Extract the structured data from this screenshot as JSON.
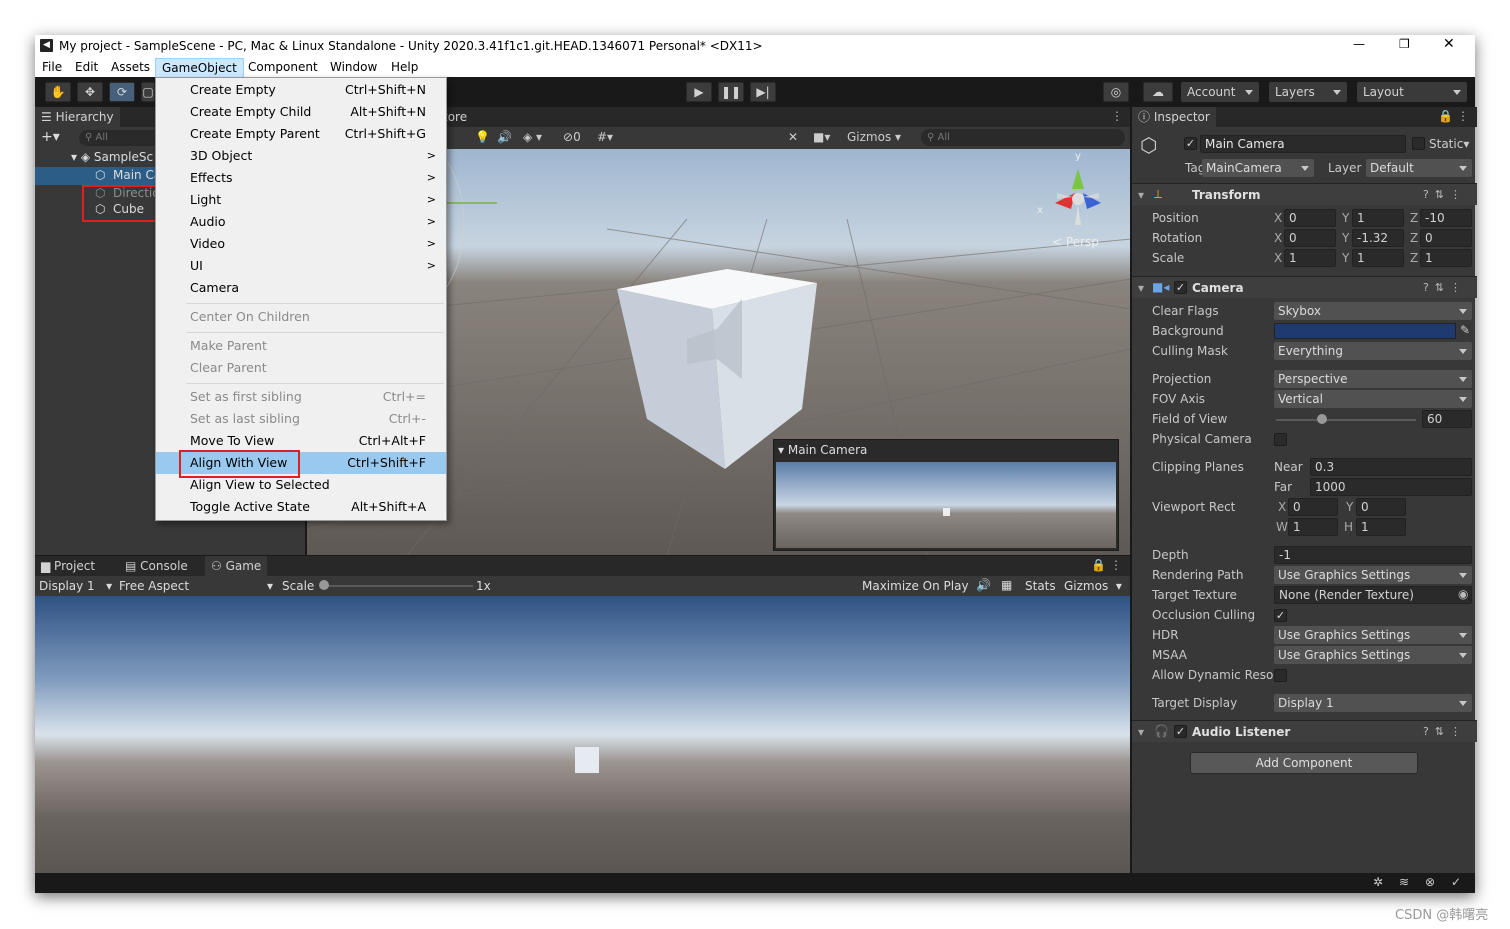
{
  "window": {
    "title": "My project - SampleScene - PC, Mac & Linux Standalone - Unity 2020.3.41f1c1.git.HEAD.1346071 Personal* <DX11>",
    "controls": [
      "—",
      "❐",
      "✕"
    ]
  },
  "menubar": [
    "File",
    "Edit",
    "Assets",
    "GameObject",
    "Component",
    "Window",
    "Help"
  ],
  "toolbar": {
    "account": "Account",
    "layers": "Layers",
    "layout": "Layout"
  },
  "hierarchy": {
    "tab": "Hierarchy",
    "search_placeholder": "All",
    "scene": "SampleSc",
    "items": [
      "Main Ca",
      "Directic",
      "Cube"
    ]
  },
  "scene_view": {
    "tab_fragment": "tore",
    "visibility_count": "0",
    "gizmos": "Gizmos",
    "search_placeholder": "All",
    "persp_label": "< Persp",
    "gizmo_y": "y",
    "gizmo_x": "x",
    "preview_title": "Main Camera"
  },
  "gameobject_menu": {
    "items": [
      {
        "label": "Create Empty",
        "shortcut": "Ctrl+Shift+N"
      },
      {
        "label": "Create Empty Child",
        "shortcut": "Alt+Shift+N"
      },
      {
        "label": "Create Empty Parent",
        "shortcut": "Ctrl+Shift+G"
      },
      {
        "label": "3D Object",
        "shortcut": ">"
      },
      {
        "label": "Effects",
        "shortcut": ">"
      },
      {
        "label": "Light",
        "shortcut": ">"
      },
      {
        "label": "Audio",
        "shortcut": ">"
      },
      {
        "label": "Video",
        "shortcut": ">"
      },
      {
        "label": "UI",
        "shortcut": ">"
      },
      {
        "label": "Camera",
        "shortcut": ""
      },
      {
        "label": "Center On Children",
        "shortcut": ""
      },
      {
        "label": "Make Parent",
        "shortcut": ""
      },
      {
        "label": "Clear Parent",
        "shortcut": ""
      },
      {
        "label": "Set as first sibling",
        "shortcut": "Ctrl+="
      },
      {
        "label": "Set as last sibling",
        "shortcut": "Ctrl+-"
      },
      {
        "label": "Move To View",
        "shortcut": "Ctrl+Alt+F"
      },
      {
        "label": "Align With View",
        "shortcut": "Ctrl+Shift+F"
      },
      {
        "label": "Align View to Selected",
        "shortcut": ""
      },
      {
        "label": "Toggle Active State",
        "shortcut": "Alt+Shift+A"
      }
    ]
  },
  "bottom_panel": {
    "tabs": [
      "Project",
      "Console",
      "Game"
    ],
    "display": "Display 1",
    "aspect": "Free Aspect",
    "scale_label": "Scale",
    "scale_value": "1x",
    "scale_level": 0.0,
    "maximize": "Maximize On Play",
    "stats": "Stats",
    "gizmos": "Gizmos"
  },
  "inspector": {
    "tab": "Inspector",
    "object_name": "Main Camera",
    "static_label": "Static",
    "tag_label": "Tag",
    "tag_value": "MainCamera",
    "layer_label": "Layer",
    "layer_value": "Default",
    "transform": {
      "title": "Transform",
      "position": {
        "label": "Position",
        "x": "0",
        "y": "1",
        "z": "-10"
      },
      "rotation": {
        "label": "Rotation",
        "x": "0",
        "y": "-1.32",
        "z": "0"
      },
      "scale": {
        "label": "Scale",
        "x": "1",
        "y": "1",
        "z": "1"
      }
    },
    "camera": {
      "title": "Camera",
      "clear_flags": {
        "label": "Clear Flags",
        "value": "Skybox"
      },
      "background": {
        "label": "Background",
        "color": "#1e3a6e"
      },
      "culling_mask": {
        "label": "Culling Mask",
        "value": "Everything"
      },
      "projection": {
        "label": "Projection",
        "value": "Perspective"
      },
      "fov_axis": {
        "label": "FOV Axis",
        "value": "Vertical"
      },
      "field_of_view": {
        "label": "Field of View",
        "value": "60",
        "slider_fraction": 0.33
      },
      "physical_camera": {
        "label": "Physical Camera"
      },
      "clipping_planes": {
        "label": "Clipping Planes",
        "near_label": "Near",
        "near": "0.3",
        "far_label": "Far",
        "far": "1000"
      },
      "viewport_rect": {
        "label": "Viewport Rect",
        "x": "0",
        "y": "0",
        "w": "1",
        "h": "1"
      },
      "depth": {
        "label": "Depth",
        "value": "-1"
      },
      "rendering_path": {
        "label": "Rendering Path",
        "value": "Use Graphics Settings"
      },
      "target_texture": {
        "label": "Target Texture",
        "value": "None (Render Texture)"
      },
      "occlusion_culling": {
        "label": "Occlusion Culling"
      },
      "hdr": {
        "label": "HDR",
        "value": "Use Graphics Settings"
      },
      "msaa": {
        "label": "MSAA",
        "value": "Use Graphics Settings"
      },
      "allow_dynamic": {
        "label": "Allow Dynamic Resol"
      },
      "target_display": {
        "label": "Target Display",
        "value": "Display 1"
      }
    },
    "audio_listener": {
      "title": "Audio Listener"
    },
    "add_component": "Add Component"
  },
  "watermark": "CSDN @韩曙亮"
}
